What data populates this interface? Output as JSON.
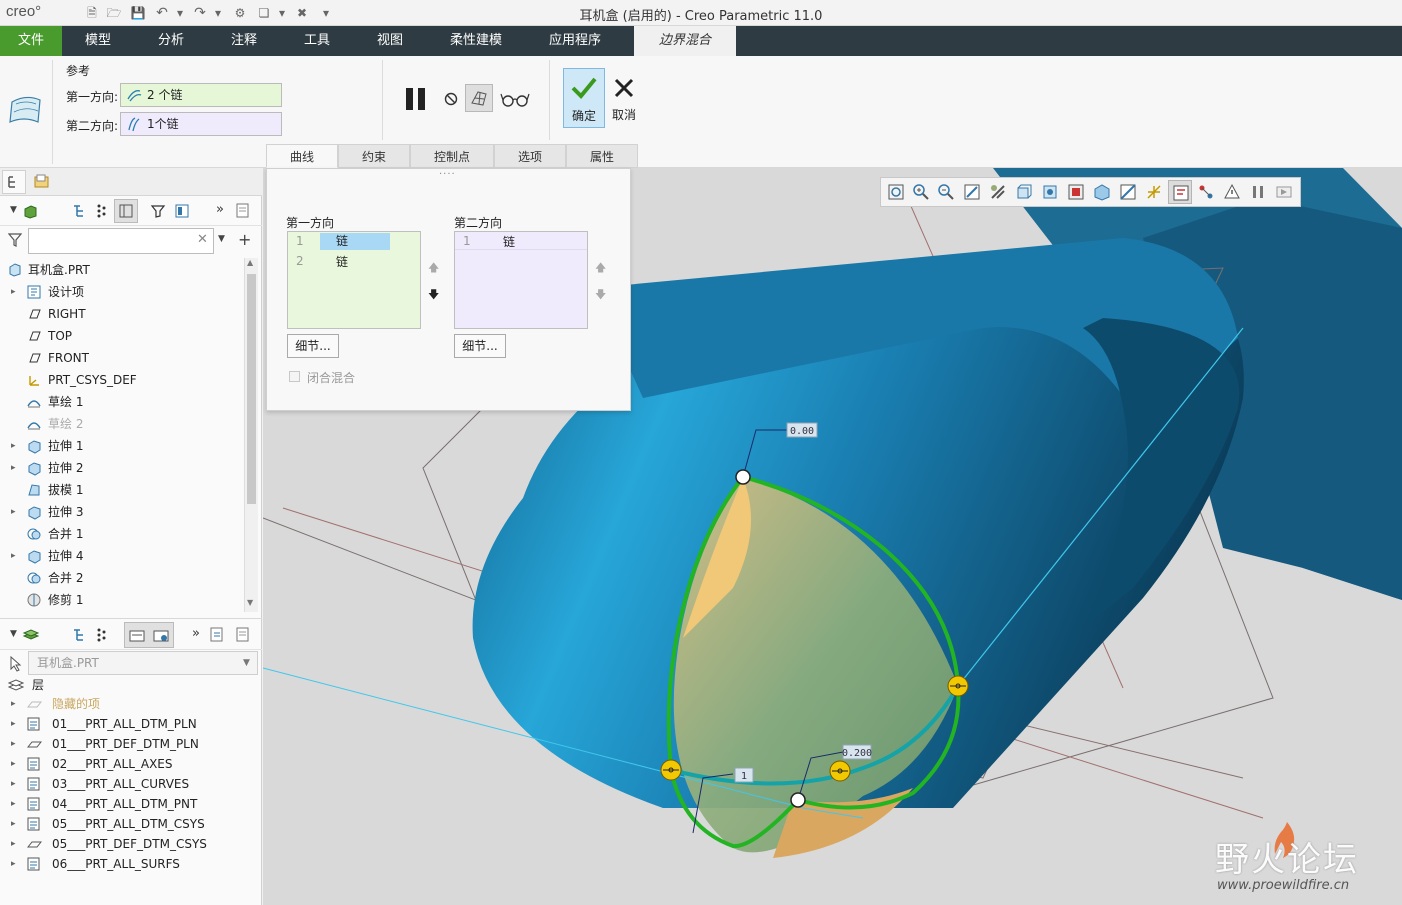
{
  "app": {
    "logo": "creo°",
    "window_title": "耳机盒 (启用的) - Creo Parametric 11.0"
  },
  "menubar": {
    "items": [
      "文件",
      "模型",
      "分析",
      "注释",
      "工具",
      "视图",
      "柔性建模",
      "应用程序"
    ],
    "active_tab": "边界混合"
  },
  "ribbon": {
    "references_label": "参考",
    "first_direction_label": "第一方向:",
    "first_direction_value": "2 个链",
    "second_direction_label": "第二方向:",
    "second_direction_value": "1个链",
    "ok_label": "确定",
    "cancel_label": "取消",
    "tabs": [
      "曲线",
      "约束",
      "控制点",
      "选项",
      "属性"
    ]
  },
  "flyout": {
    "first_dir_title": "第一方向",
    "second_dir_title": "第二方向",
    "first_dir_rows": [
      {
        "num": "1",
        "label": "链"
      },
      {
        "num": "2",
        "label": "链"
      }
    ],
    "second_dir_rows": [
      {
        "num": "1",
        "label": "链"
      }
    ],
    "details_label": "细节...",
    "closed_blend_label": "闭合混合"
  },
  "model_tree": {
    "root": "耳机盒.PRT",
    "items": [
      {
        "label": "设计项",
        "icon": "design-items-icon",
        "expandable": true
      },
      {
        "label": "RIGHT",
        "icon": "datum-plane-icon",
        "expandable": false
      },
      {
        "label": "TOP",
        "icon": "datum-plane-icon",
        "expandable": false
      },
      {
        "label": "FRONT",
        "icon": "datum-plane-icon",
        "expandable": false
      },
      {
        "label": "PRT_CSYS_DEF",
        "icon": "csys-icon",
        "expandable": false
      },
      {
        "label": "草绘 1",
        "icon": "sketch-icon",
        "expandable": false
      },
      {
        "label": "草绘 2",
        "icon": "sketch-icon",
        "expandable": false,
        "dimmed": true
      },
      {
        "label": "拉伸 1",
        "icon": "extrude-icon",
        "expandable": true
      },
      {
        "label": "拉伸 2",
        "icon": "extrude-icon",
        "expandable": true
      },
      {
        "label": "拔模 1",
        "icon": "draft-icon",
        "expandable": false
      },
      {
        "label": "拉伸 3",
        "icon": "extrude-icon",
        "expandable": true
      },
      {
        "label": "合并 1",
        "icon": "merge-icon",
        "expandable": false
      },
      {
        "label": "拉伸 4",
        "icon": "extrude-icon",
        "expandable": true
      },
      {
        "label": "合并 2",
        "icon": "merge-icon",
        "expandable": false
      },
      {
        "label": "修剪 1",
        "icon": "trim-icon",
        "expandable": false
      }
    ]
  },
  "layer_tree": {
    "model_select": "耳机盒.PRT",
    "root": "层",
    "items": [
      {
        "label": "隐藏的项",
        "dimmed": true
      },
      {
        "label": "01___PRT_ALL_DTM_PLN"
      },
      {
        "label": "01___PRT_DEF_DTM_PLN"
      },
      {
        "label": "02___PRT_ALL_AXES"
      },
      {
        "label": "03___PRT_ALL_CURVES"
      },
      {
        "label": "04___PRT_ALL_DTM_PNT"
      },
      {
        "label": "05___PRT_ALL_DTM_CSYS"
      },
      {
        "label": "05___PRT_DEF_DTM_CSYS"
      },
      {
        "label": "06___PRT_ALL_SURFS"
      }
    ]
  },
  "viewport": {
    "dim_label_1": "0.00",
    "dim_label_2": "0.200",
    "dim_label_3": "1"
  },
  "watermark": {
    "title": "野火论坛",
    "url": "www.proewildfire.cn"
  },
  "colors": {
    "accent_green": "#4a9b2e",
    "menubar_bg": "#2f3b42",
    "surface_blue": "#1a6f9a",
    "boundary_green": "#22b422"
  }
}
